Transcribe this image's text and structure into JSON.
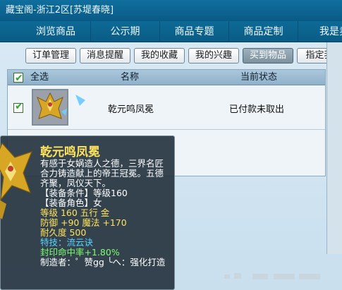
{
  "window": {
    "title": "藏宝阁-浙江2区[苏堤春晓]"
  },
  "nav": {
    "tabs": [
      "浏览商品",
      "公示期",
      "商品专题",
      "商品定制",
      "我是卖"
    ]
  },
  "subtabs": [
    "订单管理",
    "消息提醒",
    "我的收藏",
    "我的兴趣",
    "买到物品",
    "指定我"
  ],
  "active_subtab": "买到物品",
  "table": {
    "headers": {
      "select_all": "全选",
      "name": "名称",
      "status": "当前状态"
    },
    "rows": [
      {
        "name": "乾元鸣凤冕",
        "status": "已付款未取出",
        "checked": true
      }
    ]
  },
  "tooltip": {
    "title": "乾元鸣凤冕",
    "description": "有感于女娲造人之德，三界名匠合力铸造献上的帝王冠冕。五德齐聚，凤仪天下。",
    "equip_condition_label": "【装备条件】",
    "equip_condition_value": "等级160",
    "equip_role_label": "【装备角色】",
    "equip_role_value": "女",
    "level_line": "等级 160  五行 金",
    "defense_label": "防御",
    "defense_value": "+90",
    "magic_label": "魔法",
    "magic_value": "+170",
    "durability_line": "耐久度 500",
    "special_line": "特技：流云诀",
    "seal_rate_label": "封印命中率",
    "seal_rate_value": "+1.80%",
    "maker_line": "制造者：゜赞gg ╰へ：强化打造"
  },
  "colors": {
    "title_bar": "#0a5a86",
    "tooltip_title": "#ffe35c",
    "tooltip_bg": "#283642",
    "special": "#58d3ff",
    "active_subtab": "#7d919e"
  },
  "icons": [
    "phoenix-crown-icon",
    "checkbox-checked-icon"
  ]
}
